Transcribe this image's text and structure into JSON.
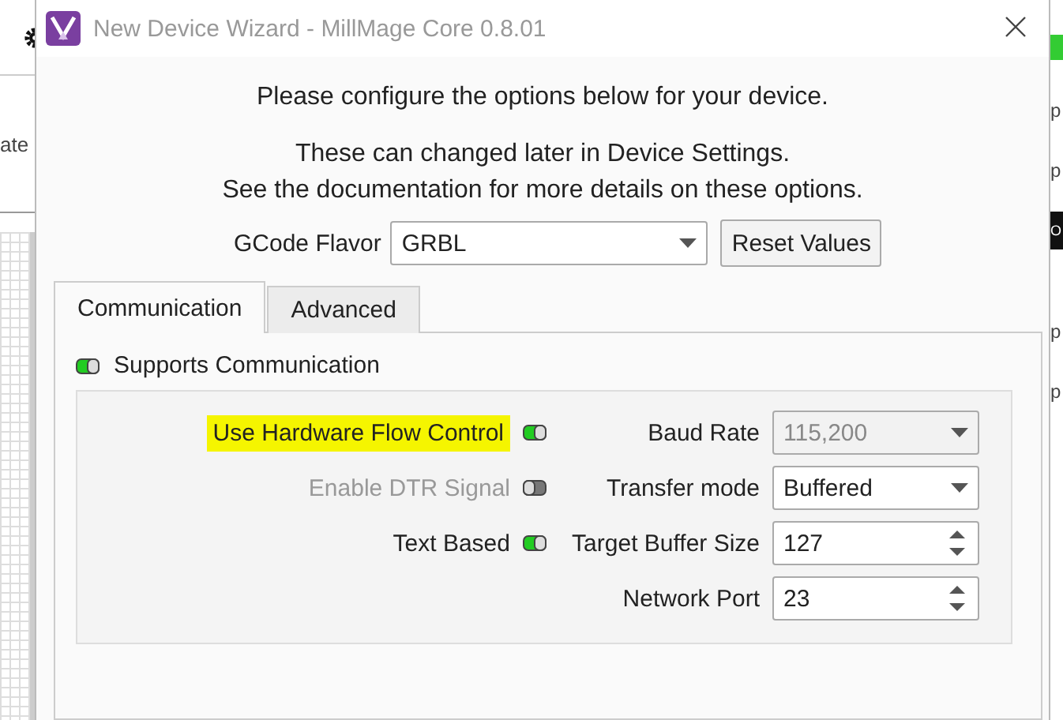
{
  "background": {
    "left_fragments": [
      "ate"
    ],
    "right_fragments": [
      {
        "text": "p",
        "kind": "plain"
      },
      {
        "text": "p",
        "kind": "plain"
      },
      {
        "text": "O",
        "kind": "dark"
      },
      {
        "text": "p",
        "kind": "plain"
      },
      {
        "text": "p",
        "kind": "plain"
      }
    ]
  },
  "window": {
    "title": "New Device Wizard - MillMage Core 0.8.01"
  },
  "intro": [
    "Please configure the options below for your device.",
    "These can changed later in Device Settings.",
    "See the documentation for more details on these options."
  ],
  "gcode_flavor": {
    "label": "GCode Flavor",
    "value": "GRBL",
    "reset_button": "Reset Values"
  },
  "tabs": [
    {
      "label": "Communication",
      "selected": true
    },
    {
      "label": "Advanced",
      "selected": false
    }
  ],
  "supports_communication": {
    "label": "Supports Communication",
    "on": true
  },
  "toggles": [
    {
      "label": "Use Hardware Flow Control",
      "on": true,
      "disabled": false,
      "highlighted": true
    },
    {
      "label": "Enable DTR Signal",
      "on": false,
      "disabled": true,
      "highlighted": false
    },
    {
      "label": "Text Based",
      "on": true,
      "disabled": false,
      "highlighted": false
    }
  ],
  "fields": [
    {
      "label": "Baud Rate",
      "value": "115,200",
      "kind": "select",
      "disabled": true
    },
    {
      "label": "Transfer mode",
      "value": "Buffered",
      "kind": "select",
      "disabled": false
    },
    {
      "label": "Target Buffer Size",
      "value": "127",
      "kind": "spin",
      "disabled": false
    },
    {
      "label": "Network Port",
      "value": "23",
      "kind": "spin",
      "disabled": false
    }
  ]
}
